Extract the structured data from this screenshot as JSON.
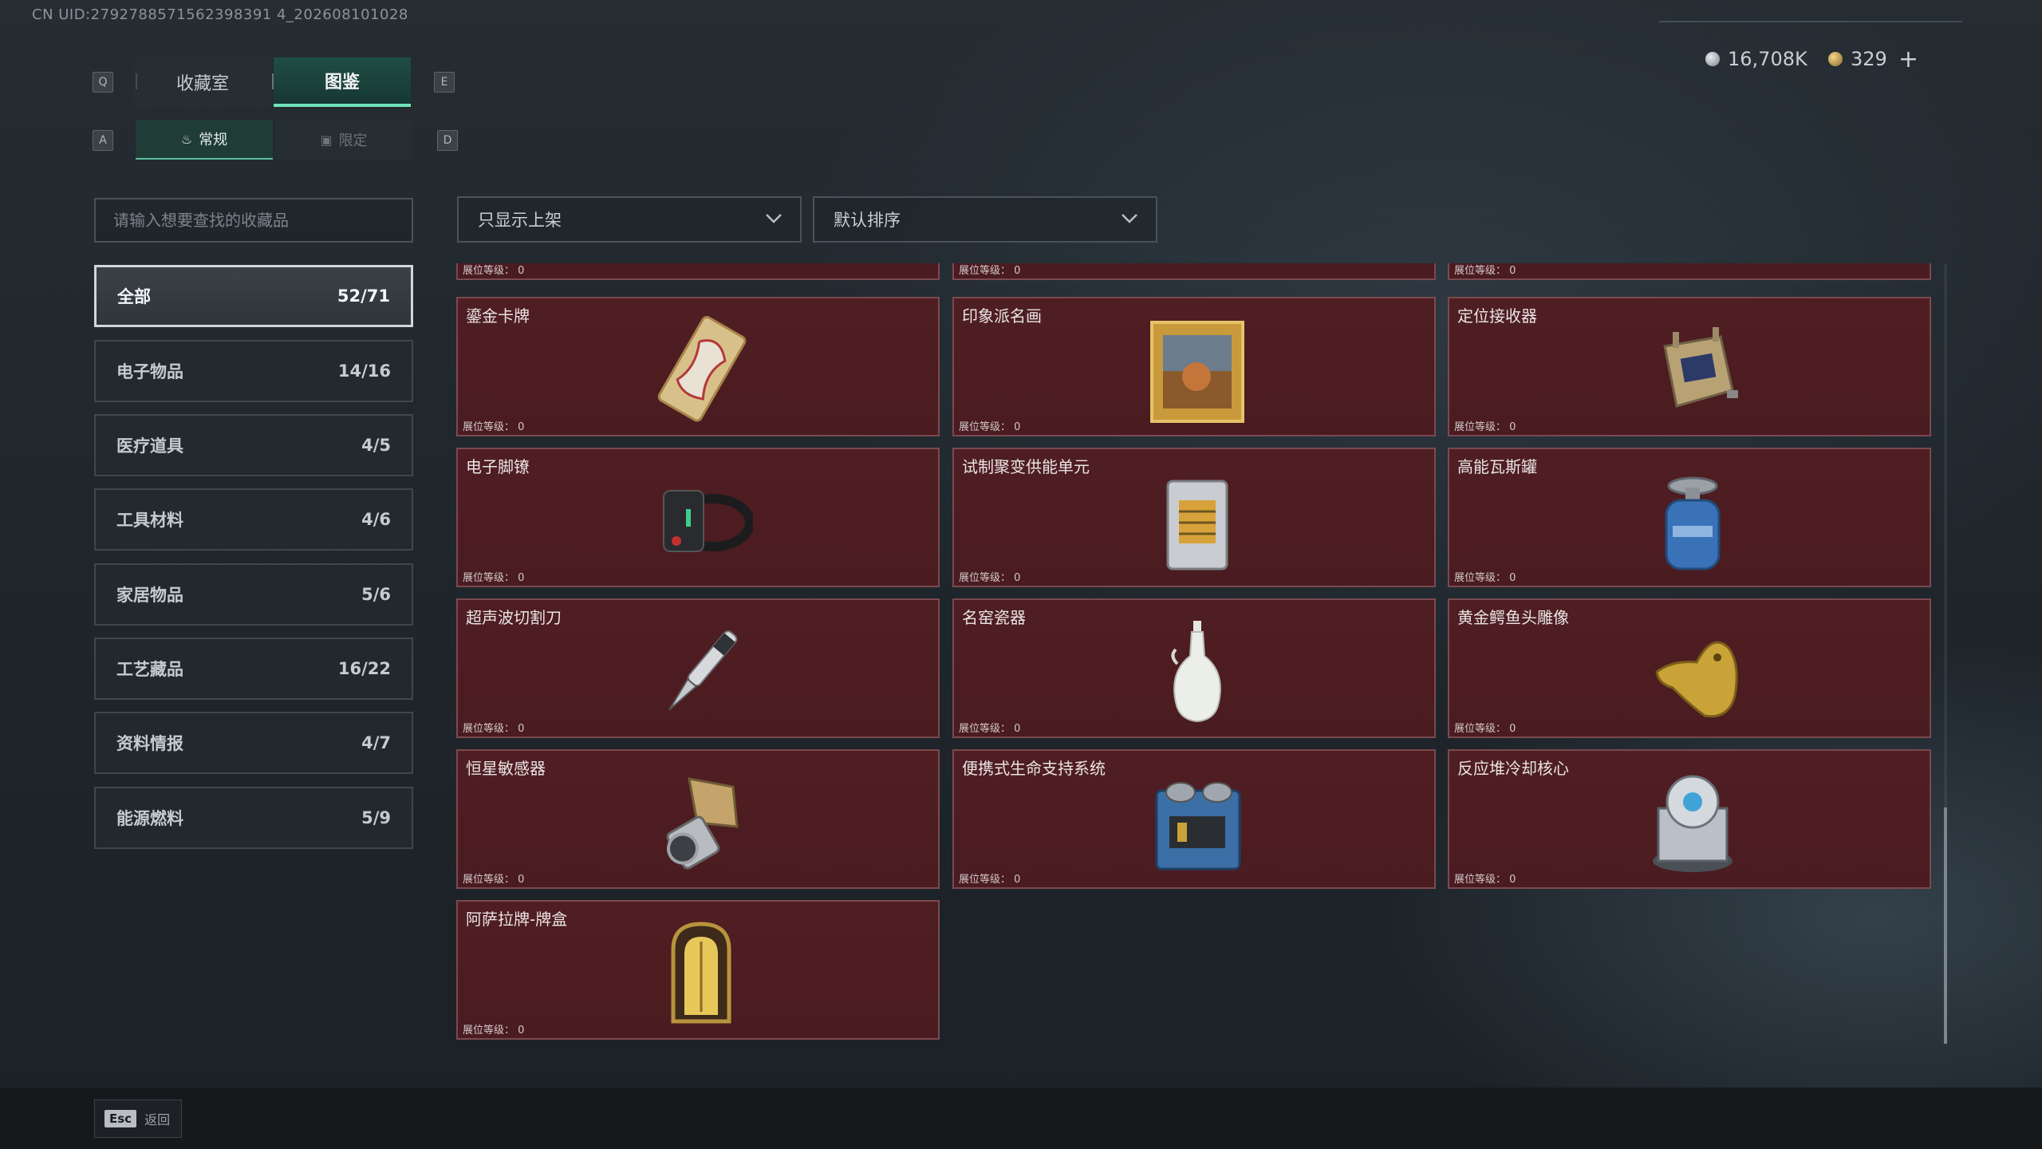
{
  "uid": "CN UID:2792788571562398391 4_202608101028",
  "currency": {
    "silver": "16,708K",
    "gold": "329",
    "plus": "+"
  },
  "keys": {
    "q": "Q",
    "e": "E",
    "a": "A",
    "d": "D"
  },
  "tabs": {
    "collection": "收藏室",
    "catalog": "图鉴"
  },
  "subtabs": {
    "regular": "常规",
    "limited": "限定"
  },
  "search": {
    "placeholder": "请输入想要查找的收藏品"
  },
  "filters": {
    "shelf": "只显示上架",
    "sort": "默认排序"
  },
  "categories": [
    {
      "label": "全部",
      "count": "52/71"
    },
    {
      "label": "电子物品",
      "count": "14/16"
    },
    {
      "label": "医疗道具",
      "count": "4/5"
    },
    {
      "label": "工具材料",
      "count": "4/6"
    },
    {
      "label": "家居物品",
      "count": "5/6"
    },
    {
      "label": "工艺藏品",
      "count": "16/22"
    },
    {
      "label": "资料情报",
      "count": "4/7"
    },
    {
      "label": "能源燃料",
      "count": "5/9"
    }
  ],
  "level_label": "展位等级： 0",
  "items": [
    {
      "name": "鎏金卡牌",
      "icon": "gilded-card-icon"
    },
    {
      "name": "印象派名画",
      "icon": "framed-painting-icon"
    },
    {
      "name": "定位接收器",
      "icon": "receiver-device-icon"
    },
    {
      "name": "电子脚镣",
      "icon": "ankle-monitor-icon"
    },
    {
      "name": "试制聚变供能单元",
      "icon": "fusion-unit-icon"
    },
    {
      "name": "高能瓦斯罐",
      "icon": "gas-canister-icon"
    },
    {
      "name": "超声波切割刀",
      "icon": "ultrasonic-knife-icon"
    },
    {
      "name": "名窑瓷器",
      "icon": "porcelain-vase-icon"
    },
    {
      "name": "黄金鳄鱼头雕像",
      "icon": "gold-crocodile-head-icon"
    },
    {
      "name": "恒星敏感器",
      "icon": "star-sensor-icon"
    },
    {
      "name": "便携式生命支持系统",
      "icon": "life-support-icon"
    },
    {
      "name": "反应堆冷却核心",
      "icon": "reactor-core-icon"
    },
    {
      "name": "阿萨拉牌-牌盒",
      "icon": "card-box-icon"
    }
  ],
  "footer": {
    "esc_key": "Esc",
    "back": "返回"
  }
}
